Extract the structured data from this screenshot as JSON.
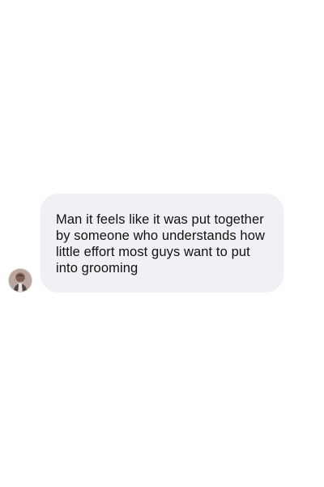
{
  "message": {
    "text": "Man it feels like it was put together by someone who understands how little effort most guys want to put into grooming",
    "bubble_color": "#f0f1f5",
    "text_color": "#111111"
  },
  "sender": {
    "avatar_icon": "profile-photo"
  }
}
